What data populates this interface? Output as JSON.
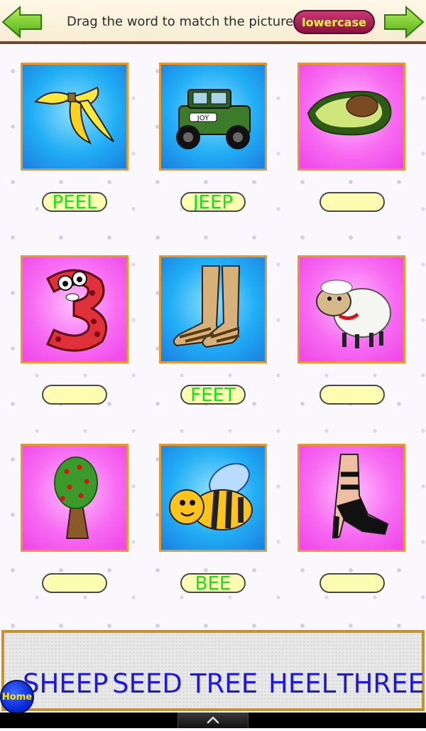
{
  "header": {
    "instruction": "Drag the word to match the picture",
    "case_button": "lowercase",
    "back_icon": "left-arrow-icon",
    "next_icon": "right-arrow-icon"
  },
  "tiles": [
    {
      "picture": "banana-peel",
      "background": "blue",
      "answer": "PEEL"
    },
    {
      "picture": "jeep",
      "background": "blue",
      "answer": "JEEP"
    },
    {
      "picture": "avocado-seed",
      "background": "pink",
      "answer": ""
    },
    {
      "picture": "number-three",
      "background": "pink",
      "answer": ""
    },
    {
      "picture": "feet-in-sandals",
      "background": "blue",
      "answer": "FEET"
    },
    {
      "picture": "sheep",
      "background": "pink",
      "answer": ""
    },
    {
      "picture": "tree",
      "background": "pink",
      "answer": ""
    },
    {
      "picture": "bee",
      "background": "blue",
      "answer": "BEE"
    },
    {
      "picture": "high-heel-shoe",
      "background": "pink",
      "answer": ""
    }
  ],
  "jeep_plate": "JOY",
  "word_bank": [
    "SHEEP",
    "SEED",
    "TREE",
    "HEEL",
    "THREE"
  ],
  "home_button": "Home",
  "colors": {
    "answer_text": "#11e41a",
    "word_bank_text": "#1d17e6",
    "tile_border": "#e9962b",
    "case_button_bg": "#a8245a",
    "case_button_text": "#fff34a"
  }
}
